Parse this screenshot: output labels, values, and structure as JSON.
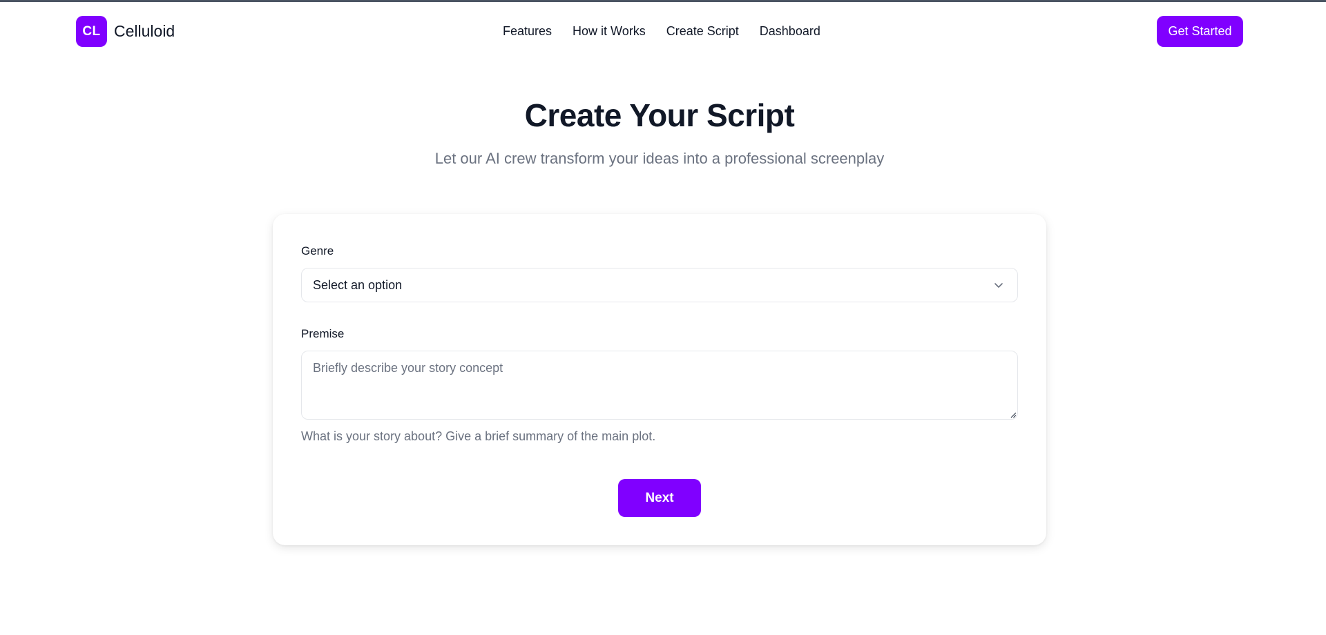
{
  "brand": {
    "logo_initials": "CL",
    "name": "Celluloid",
    "accent_color": "#8000ff"
  },
  "nav": {
    "items": [
      {
        "label": "Features"
      },
      {
        "label": "How it Works"
      },
      {
        "label": "Create Script"
      },
      {
        "label": "Dashboard"
      }
    ],
    "cta_label": "Get Started"
  },
  "hero": {
    "title": "Create Your Script",
    "subtitle": "Let our AI crew transform your ideas into a professional screenplay"
  },
  "form": {
    "genre": {
      "label": "Genre",
      "selected": "Select an option",
      "icon": "chevron-down-icon"
    },
    "premise": {
      "label": "Premise",
      "placeholder": "Briefly describe your story concept",
      "value": "",
      "hint": "What is your story about? Give a brief summary of the main plot."
    },
    "next_label": "Next"
  }
}
